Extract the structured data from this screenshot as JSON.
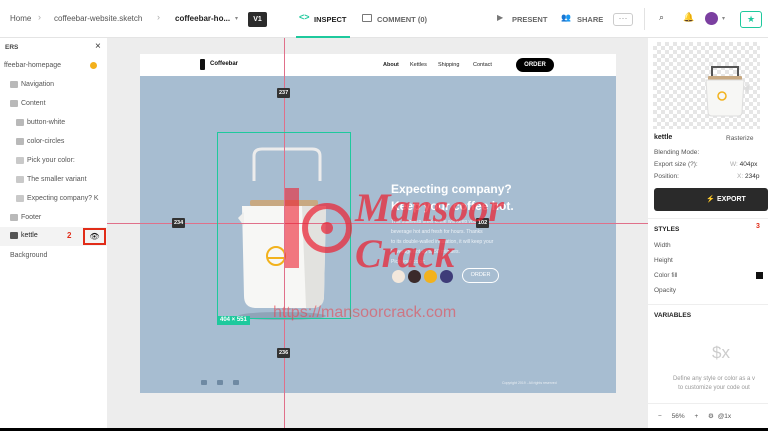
{
  "topbar": {
    "home": "Home",
    "file": "coffeebar-website.sketch",
    "page": "coffeebar-ho...",
    "version": "V1",
    "inspect": "INSPECT",
    "comment": "COMMENT (0)",
    "present": "PRESENT",
    "share": "SHARE"
  },
  "layers": {
    "title": "ERS",
    "items": [
      {
        "label": "ffeebar-homepage"
      },
      {
        "label": "Navigation"
      },
      {
        "label": "Content"
      },
      {
        "label": "button-white"
      },
      {
        "label": "color-circles"
      },
      {
        "label": "Pick your color:"
      },
      {
        "label": "The smaller variant"
      },
      {
        "label": "Expecting company? K"
      },
      {
        "label": "Footer"
      },
      {
        "label": "kettle"
      },
      {
        "label": "Background"
      }
    ],
    "annotation": "2"
  },
  "artboard": {
    "brand": "Coffeebar",
    "nav": [
      "About",
      "Kettles",
      "Shipping",
      "Contact"
    ],
    "order": "ORDER",
    "headline_1": "Expecting company?",
    "headline_2": "Keep your coffee hot.",
    "body_1": "This stainless steel kettle will keep your",
    "body_2": "beverage hot and fresh for hours. Thanks",
    "body_3": "to its double-walled insulation, it will keep your",
    "body_4": "beverage hot up to 50 minutes.",
    "pick": "Pick your color:",
    "button": "ORDER",
    "copyright": "Copyright 2019 - All rights reserved",
    "swatches": [
      "#f3e8dc",
      "#3b2a2a",
      "#f2b21d",
      "#3e3c79"
    ]
  },
  "measure": {
    "top": "237",
    "left": "234",
    "right": "102",
    "bottom": "236",
    "size": "404 × 551"
  },
  "watermark": {
    "line1": "Mansoor",
    "line2": "Crack",
    "url": "https://mansoorcrack.com"
  },
  "inspector": {
    "layer_name": "kettle",
    "rasterize": "Rasterize",
    "blending_label": "Blending Mode:",
    "export_size_label": "Export size (?):",
    "export_size_key": "W:",
    "export_size_val": "404px",
    "position_label": "Position:",
    "position_key": "X:",
    "position_val": "234p",
    "export": "EXPORT",
    "styles": "STYLES",
    "styles_num": "3",
    "width": "Width",
    "height": "Height",
    "color_fill": "Color fill",
    "opacity": "Opacity",
    "variables": "VARIABLES",
    "empty_icon": "$x",
    "empty_1": "Define any style or color as a v",
    "empty_2": "to customize your code out",
    "zoom": "56%",
    "scale": "@1x"
  },
  "colors": {
    "accent": "#1ec99d",
    "artboard_bg": "#a7bdd1",
    "annotation": "#e12c18"
  }
}
